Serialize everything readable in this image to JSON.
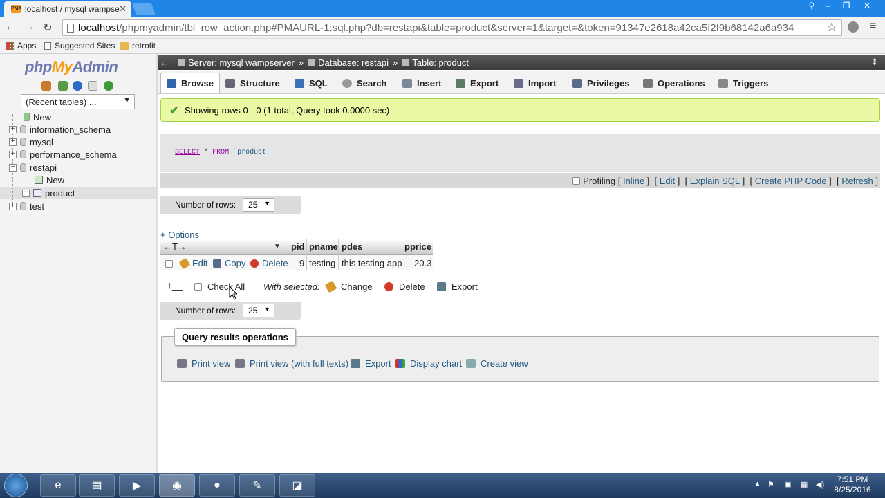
{
  "browser": {
    "tab_title": "localhost / mysql wampse",
    "tab_favicon": "PMA",
    "url_host": "localhost",
    "url_path": "/phpmyadmin/tbl_row_action.php#PMAURL-1:sql.php?db=restapi&table=product&server=1&target=&token=91347e2618a42ca5f2f9b68142a6a934",
    "bookmarks": [
      {
        "label": "Apps",
        "icon": "apps-grid-icon"
      },
      {
        "label": "Suggested Sites",
        "icon": "page-icon"
      },
      {
        "label": "retrofit",
        "icon": "folder-icon"
      }
    ]
  },
  "sidebar": {
    "logo_php": "php",
    "logo_my": "My",
    "logo_admin": "Admin",
    "recent_tables": "(Recent tables) ...",
    "tree": [
      {
        "label": "New",
        "level": 0,
        "expander": ""
      },
      {
        "label": "information_schema",
        "level": 0,
        "expander": "+"
      },
      {
        "label": "mysql",
        "level": 0,
        "expander": "+"
      },
      {
        "label": "performance_schema",
        "level": 0,
        "expander": "+"
      },
      {
        "label": "restapi",
        "level": 0,
        "expander": "−"
      },
      {
        "label": "New",
        "level": 1,
        "expander": ""
      },
      {
        "label": "product",
        "level": 1,
        "expander": "+"
      },
      {
        "label": "test",
        "level": 0,
        "expander": "+"
      }
    ]
  },
  "breadcrumb": {
    "server": "Server: mysql wampserver",
    "database": "Database: restapi",
    "table": "Table: product",
    "sep": "»"
  },
  "tabs": [
    {
      "label": "Browse",
      "icon": "browse-icon"
    },
    {
      "label": "Structure",
      "icon": "structure-icon"
    },
    {
      "label": "SQL",
      "icon": "sql-icon"
    },
    {
      "label": "Search",
      "icon": "search-icon"
    },
    {
      "label": "Insert",
      "icon": "insert-icon"
    },
    {
      "label": "Export",
      "icon": "export-icon"
    },
    {
      "label": "Import",
      "icon": "import-icon"
    },
    {
      "label": "Privileges",
      "icon": "privileges-icon"
    },
    {
      "label": "Operations",
      "icon": "operations-icon"
    },
    {
      "label": "Triggers",
      "icon": "triggers-icon"
    }
  ],
  "success_message": "Showing rows 0 - 0 (1 total, Query took 0.0000 sec)",
  "sql": {
    "kw": "SELECT",
    "op": "*",
    "from": "FROM",
    "table": "`product`"
  },
  "sql_tools": {
    "profiling": "Profiling",
    "inline": "Inline",
    "edit": "Edit",
    "explain": "Explain SQL",
    "create_php": "Create PHP Code",
    "refresh": "Refresh"
  },
  "rows_control": {
    "label": "Number of rows:",
    "value": "25"
  },
  "options_link": "+ Options",
  "table": {
    "sort_arrows": "←T→",
    "columns": [
      "pid",
      "pname",
      "pdes",
      "pprice"
    ],
    "row": {
      "edit": "Edit",
      "copy": "Copy",
      "delete": "Delete",
      "pid": "9",
      "pname": "testing",
      "pdes": "this testing app",
      "pprice": "20.3"
    }
  },
  "bulk": {
    "check_all": "Check All",
    "with_selected": "With selected:",
    "change": "Change",
    "delete": "Delete",
    "export": "Export"
  },
  "query_ops": {
    "legend": "Query results operations",
    "print_view": "Print view",
    "print_view_full": "Print view (with full texts)",
    "export": "Export",
    "display_chart": "Display chart",
    "create_view": "Create view"
  },
  "taskbar": {
    "time": "7:51 PM",
    "date": "8/25/2016"
  }
}
